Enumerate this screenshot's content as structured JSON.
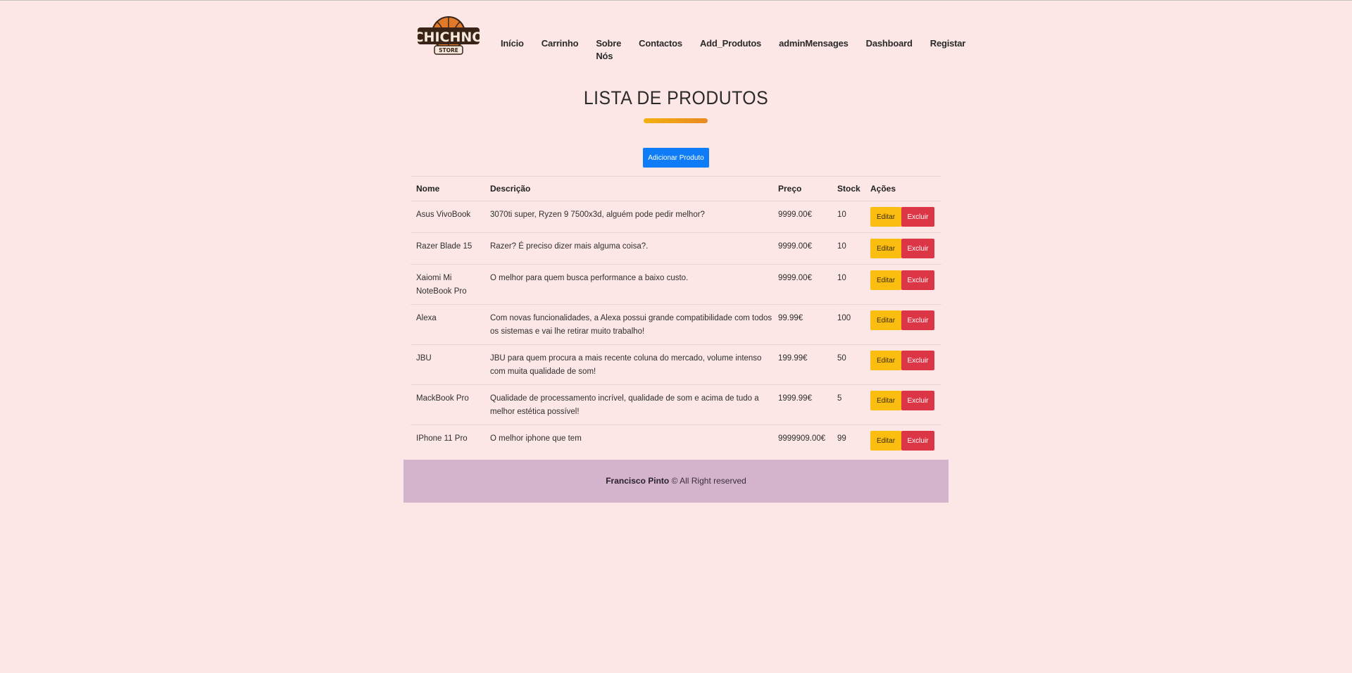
{
  "brand": {
    "logo_text": "CHICHNO",
    "logo_subtext": "STORE"
  },
  "nav": [
    {
      "label": "Início",
      "name": "nav-inicio"
    },
    {
      "label": "Carrinho",
      "name": "nav-carrinho"
    },
    {
      "label": "Sobre Nós",
      "name": "nav-sobre-nos"
    },
    {
      "label": "Contactos",
      "name": "nav-contactos"
    },
    {
      "label": "Add_Produtos",
      "name": "nav-add-produtos"
    },
    {
      "label": "adminMensages",
      "name": "nav-admin-mensages"
    },
    {
      "label": "Dashboard",
      "name": "nav-dashboard"
    },
    {
      "label": "Registar",
      "name": "nav-registar"
    }
  ],
  "page": {
    "title": "LISTA DE PRODUTOS",
    "add_button": "Adicionar Produto"
  },
  "table": {
    "headers": [
      "Nome",
      "Descrição",
      "Preço",
      "Stock",
      "Ações"
    ],
    "edit_label": "Editar",
    "delete_label": "Excluir",
    "rows": [
      {
        "nome": "Asus VivoBook",
        "descricao": "3070ti super, Ryzen 9 7500x3d, alguém pode pedir melhor?",
        "preco": "9999.00€",
        "stock": "10"
      },
      {
        "nome": "Razer Blade 15",
        "descricao": "Razer? É preciso dizer mais alguma coisa?.",
        "preco": "9999.00€",
        "stock": "10"
      },
      {
        "nome": "Xaiomi Mi NoteBook Pro",
        "descricao": "O melhor para quem busca performance a baixo custo.",
        "preco": "9999.00€",
        "stock": "10"
      },
      {
        "nome": "Alexa",
        "descricao": "Com novas funcionalidades, a Alexa possui grande compatibilidade com todos os sistemas e vai lhe retirar muito trabalho!",
        "preco": "99.99€",
        "stock": "100"
      },
      {
        "nome": "JBU",
        "descricao": "JBU para quem procura a mais recente coluna do mercado, volume intenso com muita qualidade de som!",
        "preco": "199.99€",
        "stock": "50"
      },
      {
        "nome": "MackBook Pro",
        "descricao": "Qualidade de processamento incrível, qualidade de som e acima de tudo a melhor estética possível!",
        "preco": "1999.99€",
        "stock": "5"
      },
      {
        "nome": "IPhone 11 Pro",
        "descricao": "O melhor iphone que tem",
        "preco": "9999909.00€",
        "stock": "99"
      }
    ]
  },
  "footer": {
    "author": "Francisco Pinto",
    "rights": "© All Right reserved"
  },
  "colors": {
    "background": "#fce6e6",
    "primary": "#0d7cf6",
    "warning": "#fbbe10",
    "danger": "#dc3545",
    "footer": "#d4b3cc"
  }
}
